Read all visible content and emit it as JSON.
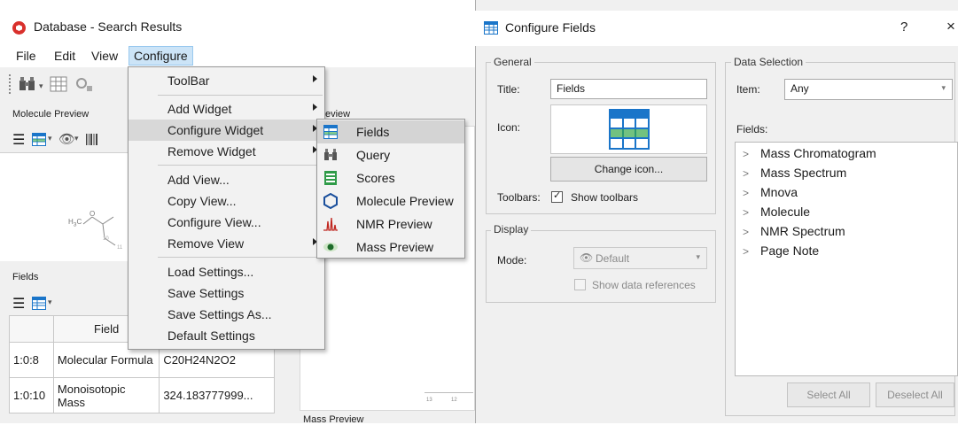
{
  "app": {
    "title": "Database - Search Results",
    "menu": [
      "File",
      "Edit",
      "View",
      "Configure"
    ],
    "panels": {
      "molecule_preview": "Molecule Preview",
      "nmr_preview": "R Preview",
      "fields": "Fields",
      "mass_preview": "Mass Preview"
    },
    "molecule_atoms": {
      "c1": "H",
      "c2": "C",
      "sub3": "3",
      "o": "O",
      "n10": "10",
      "n11": "11"
    },
    "nmr_ticks": [
      "13",
      "12"
    ],
    "table": {
      "header_col2": "Field",
      "rows": [
        {
          "id": "1:0:8",
          "field": "Molecular Formula",
          "value": "C20H24N2O2"
        },
        {
          "id": "1:0:10",
          "field": "Monoisotopic Mass",
          "value": "324.183777999..."
        }
      ]
    }
  },
  "configure_menu": {
    "items": [
      {
        "label": "ToolBar",
        "submenu": true
      },
      {
        "label": "Add Widget",
        "submenu": true
      },
      {
        "label": "Configure Widget",
        "submenu": true,
        "highlighted": true
      },
      {
        "label": "Remove Widget",
        "submenu": true
      },
      {
        "label": "Add View..."
      },
      {
        "label": "Copy View..."
      },
      {
        "label": "Configure View..."
      },
      {
        "label": "Remove View",
        "submenu": true
      },
      {
        "label": "Load Settings..."
      },
      {
        "label": "Save Settings"
      },
      {
        "label": "Save Settings As..."
      },
      {
        "label": "Default Settings"
      }
    ]
  },
  "widget_submenu": {
    "items": [
      {
        "label": "Fields",
        "icon": "fields-grid-icon",
        "highlighted": true
      },
      {
        "label": "Query",
        "icon": "binoculars-icon"
      },
      {
        "label": "Scores",
        "icon": "scores-list-icon"
      },
      {
        "label": "Molecule Preview",
        "icon": "hexagon-icon"
      },
      {
        "label": "NMR Preview",
        "icon": "nmr-peaks-icon"
      },
      {
        "label": "Mass Preview",
        "icon": "eye-icon"
      }
    ]
  },
  "dialog": {
    "title": "Configure Fields",
    "help": "?",
    "close": "×",
    "general": {
      "title": "General",
      "title_label": "Title:",
      "title_value": "Fields",
      "icon_label": "Icon:",
      "change_icon": "Change icon...",
      "toolbars_label": "Toolbars:",
      "show_toolbars": "Show toolbars",
      "show_toolbars_checked": true
    },
    "display": {
      "title": "Display",
      "mode_label": "Mode:",
      "mode_value": "Default",
      "show_data_refs": "Show data references",
      "show_data_refs_checked": false
    },
    "data_selection": {
      "title": "Data Selection",
      "item_label": "Item:",
      "item_value": "Any",
      "fields_label": "Fields:",
      "fields": [
        "Mass Chromatogram",
        "Mass Spectrum",
        "Mnova",
        "Molecule",
        "NMR Spectrum",
        "Page Note"
      ],
      "select_all": "Select All",
      "deselect_all": "Deselect All"
    }
  },
  "colors": {
    "menu_highlight": "#d8d8d8",
    "menubar_active": "#cce4f7",
    "accent_red": "#d9302c",
    "fields_icon_blue": "#1a75c9",
    "fields_icon_green": "#36a84a"
  }
}
